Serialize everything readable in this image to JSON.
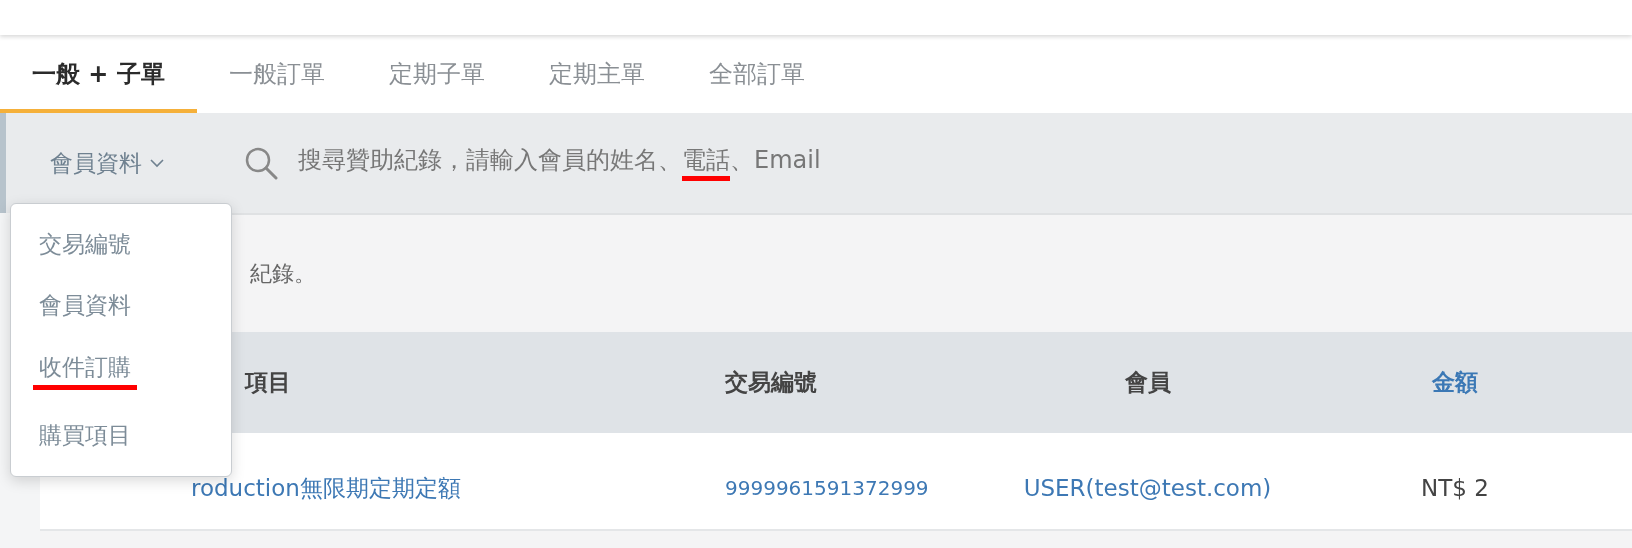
{
  "tabs": [
    {
      "label": "一般 + 子單",
      "selected": true
    },
    {
      "label": "一般訂單",
      "selected": false
    },
    {
      "label": "定期子單",
      "selected": false
    },
    {
      "label": "定期主單",
      "selected": false
    },
    {
      "label": "全部訂單",
      "selected": false
    }
  ],
  "search": {
    "filter": {
      "label": "會員資料",
      "expanded": true,
      "options": [
        {
          "label": "交易編號",
          "marked": false
        },
        {
          "label": "會員資料",
          "marked": false
        },
        {
          "label": "收件訂購",
          "marked": true
        },
        {
          "label": "購買項目",
          "marked": false
        }
      ]
    },
    "placeholder_parts": [
      {
        "text": "搜尋贊助紀錄，請輸入會員的姓名、",
        "marked": false
      },
      {
        "text": "電話",
        "marked": true
      },
      {
        "text": "、Email",
        "marked": false
      }
    ]
  },
  "notice": "紀錄。",
  "table": {
    "columns": [
      {
        "label": "項目",
        "sortable": false
      },
      {
        "label": "交易編號",
        "sortable": false
      },
      {
        "label": "會員",
        "sortable": false
      },
      {
        "label": "金額",
        "sortable": true
      }
    ],
    "rows": [
      {
        "cells": [
          {
            "text": "roduction無限期定期定額",
            "link": true
          },
          {
            "text": "9999961591372999",
            "link": true
          },
          {
            "text": "USER(test@test.com)",
            "link": true
          },
          {
            "text": "NT$ 2",
            "link": false
          }
        ]
      }
    ]
  }
}
